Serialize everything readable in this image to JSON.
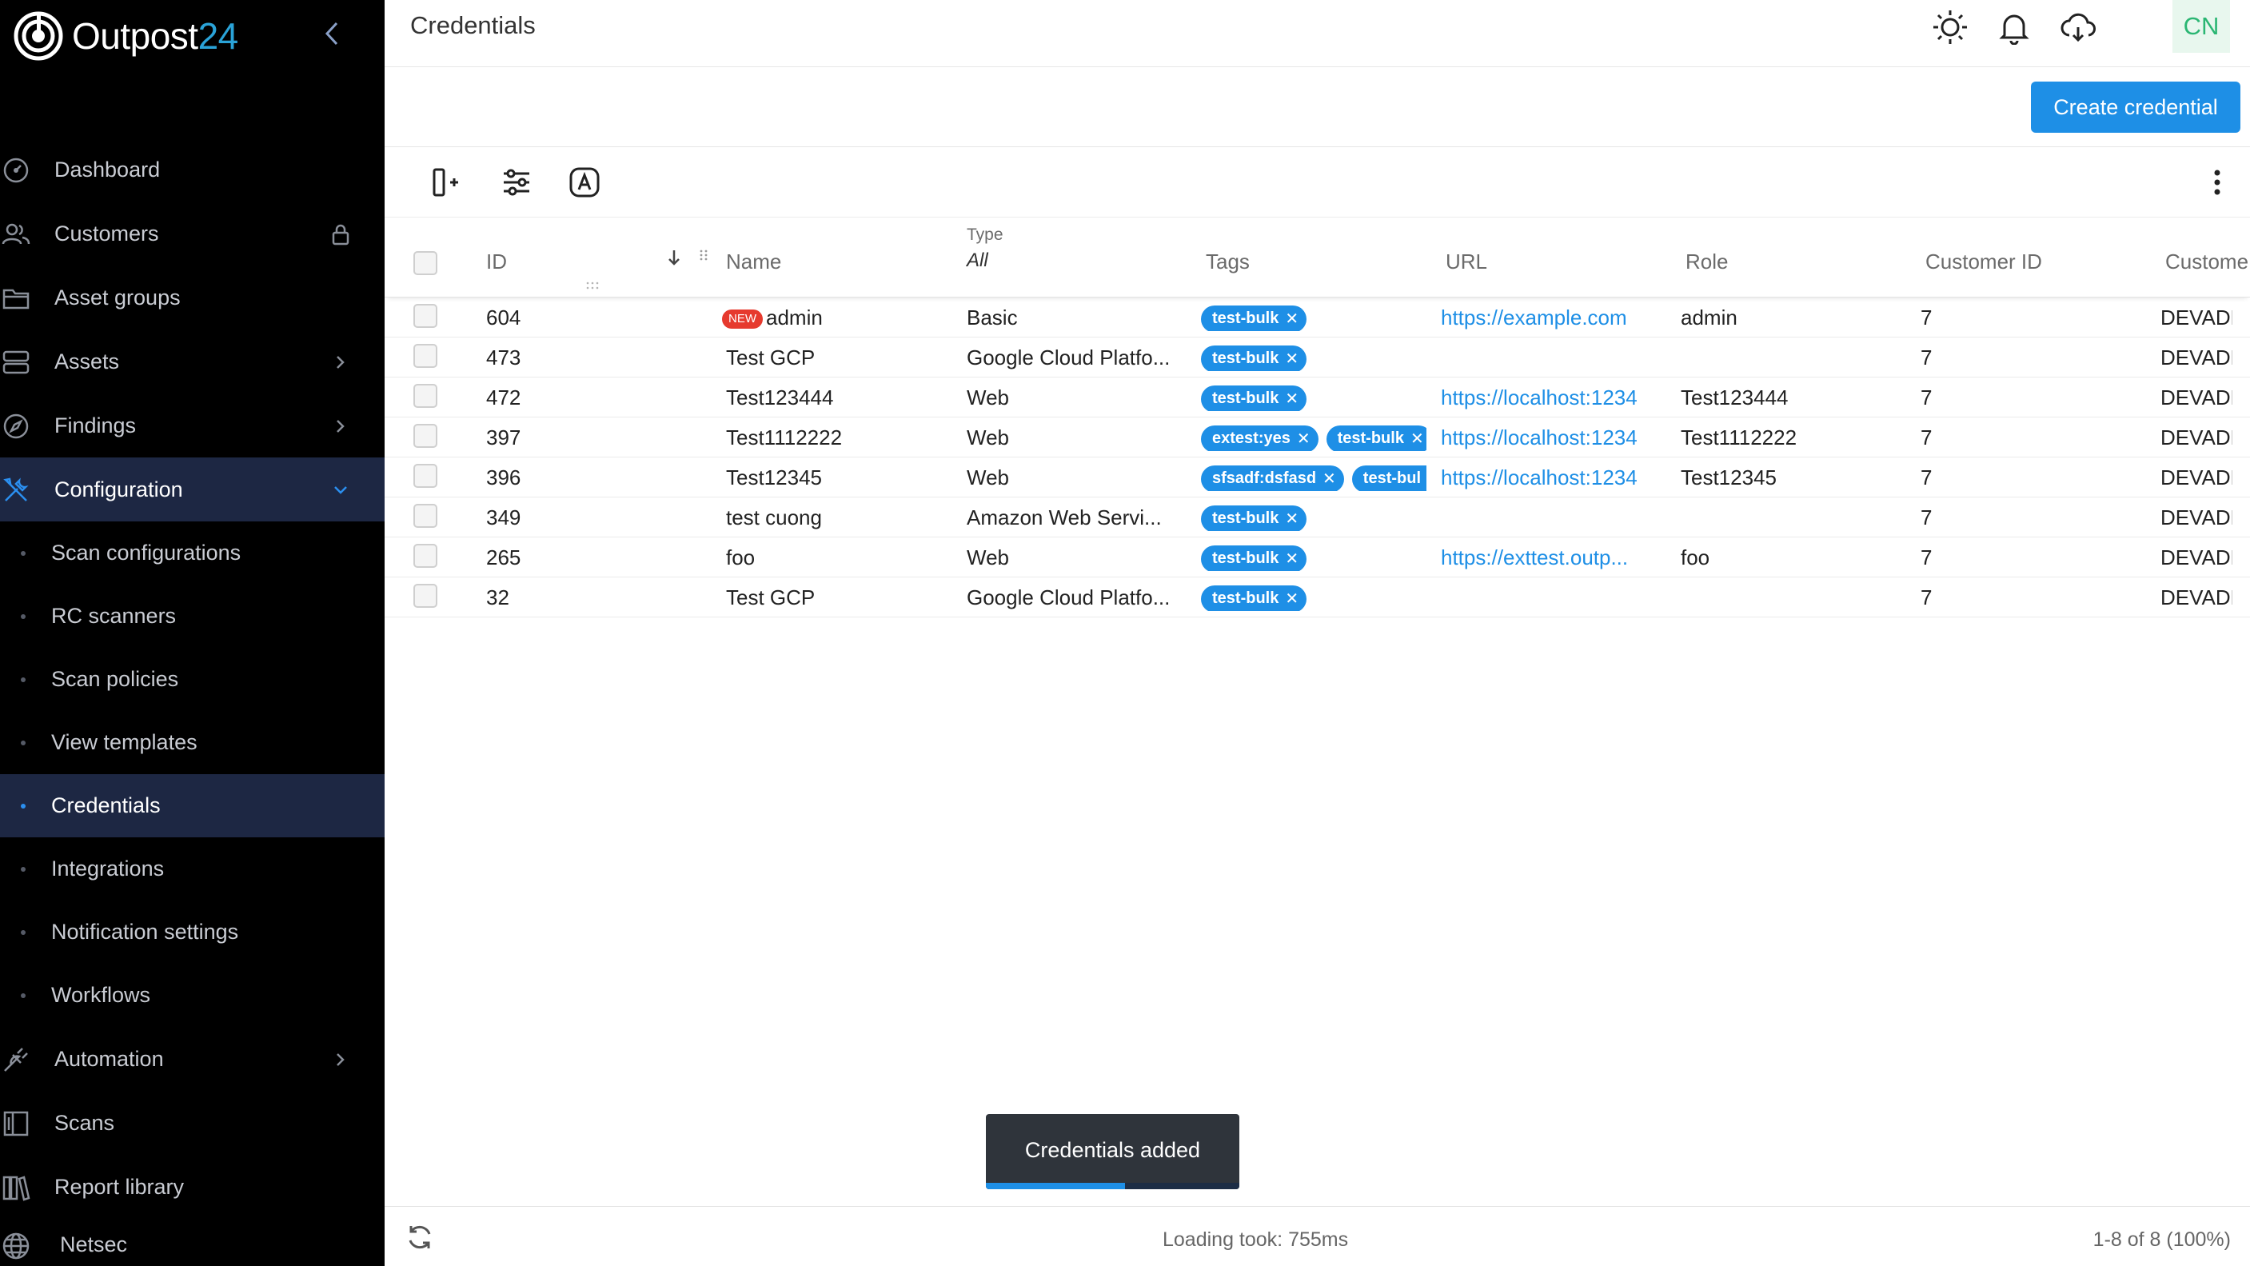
{
  "brand": {
    "name": "Outpost",
    "name_num": "24"
  },
  "nav": {
    "items": [
      {
        "label": "Dashboard",
        "icon": "dashboard-icon"
      },
      {
        "label": "Customers",
        "icon": "users-icon",
        "trailing": "lock-icon"
      },
      {
        "label": "Asset groups",
        "icon": "folder-icon"
      },
      {
        "label": "Assets",
        "icon": "server-icon",
        "trailing": "chevron-right-icon"
      },
      {
        "label": "Findings",
        "icon": "compass-icon",
        "trailing": "chevron-right-icon"
      },
      {
        "label": "Configuration",
        "icon": "tools-icon",
        "trailing": "chevron-down-icon",
        "active": true
      }
    ],
    "config_sub": [
      {
        "label": "Scan configurations"
      },
      {
        "label": "RC scanners"
      },
      {
        "label": "Scan policies"
      },
      {
        "label": "View templates"
      },
      {
        "label": "Credentials",
        "current": true
      },
      {
        "label": "Integrations"
      },
      {
        "label": "Notification settings"
      },
      {
        "label": "Workflows"
      }
    ],
    "bottom_items": [
      {
        "label": "Automation",
        "icon": "plug-icon",
        "trailing": "chevron-right-icon"
      },
      {
        "label": "Scans",
        "icon": "scan-icon"
      },
      {
        "label": "Report library",
        "icon": "books-icon"
      },
      {
        "label": "Netsec",
        "icon": "globe-icon"
      }
    ]
  },
  "header": {
    "title": "Credentials",
    "avatar": "CN"
  },
  "actions": {
    "create_label": "Create credential"
  },
  "table": {
    "columns": {
      "id": "ID",
      "name": "Name",
      "type_label": "Type",
      "type_filter": "All",
      "tags": "Tags",
      "url": "URL",
      "role": "Role",
      "customer_id": "Customer ID",
      "customer": "Custome"
    },
    "new_badge": "NEW",
    "rows": [
      {
        "id": "604",
        "name": "admin",
        "is_new": true,
        "type": "Basic",
        "tags": [
          "test-bulk"
        ],
        "url": "https://example.com",
        "role": "admin",
        "customer_id": "7",
        "customer": "DEVADMI"
      },
      {
        "id": "473",
        "name": "Test GCP",
        "type": "Google Cloud Platfo...",
        "tags": [
          "test-bulk"
        ],
        "url": "",
        "role": "",
        "customer_id": "7",
        "customer": "DEVADMI"
      },
      {
        "id": "472",
        "name": "Test123444",
        "type": "Web",
        "tags": [
          "test-bulk"
        ],
        "url": "https://localhost:1234",
        "role": "Test123444",
        "customer_id": "7",
        "customer": "DEVADMI"
      },
      {
        "id": "397",
        "name": "Test1112222",
        "type": "Web",
        "tags": [
          "extest:yes",
          "test-bulk"
        ],
        "url": "https://localhost:1234",
        "role": "Test1112222",
        "customer_id": "7",
        "customer": "DEVADMI"
      },
      {
        "id": "396",
        "name": "Test12345",
        "type": "Web",
        "tags": [
          "sfsadf:dsfasd",
          "test-bul"
        ],
        "url": "https://localhost:1234",
        "role": "Test12345",
        "customer_id": "7",
        "customer": "DEVADMI"
      },
      {
        "id": "349",
        "name": "test cuong",
        "type": "Amazon Web Servi...",
        "tags": [
          "test-bulk"
        ],
        "url": "",
        "role": "",
        "customer_id": "7",
        "customer": "DEVADMI"
      },
      {
        "id": "265",
        "name": "foo",
        "type": "Web",
        "tags": [
          "test-bulk"
        ],
        "url": "https://exttest.outp...",
        "role": "foo",
        "customer_id": "7",
        "customer": "DEVADMI"
      },
      {
        "id": "32",
        "name": "Test GCP",
        "type": "Google Cloud Platfo...",
        "tags": [
          "test-bulk"
        ],
        "url": "",
        "role": "",
        "customer_id": "7",
        "customer": "DEVADMI"
      }
    ]
  },
  "toast": {
    "message": "Credentials added",
    "progress": 0.55
  },
  "footer": {
    "loading": "Loading took: 755ms",
    "pager": "1-8 of 8 (100%)"
  },
  "colors": {
    "accent": "#1e8fe6",
    "sidebar_bg": "#000000",
    "sidebar_active": "#1d2743",
    "new_badge": "#e63a2e"
  }
}
